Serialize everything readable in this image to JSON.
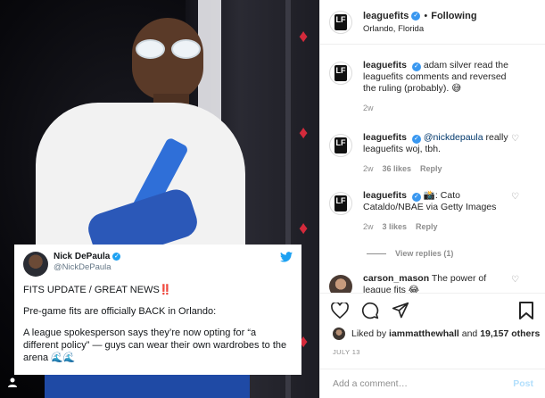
{
  "header": {
    "username": "leaguefits",
    "separator": "•",
    "follow_label": "Following",
    "location": "Orlando, Florida",
    "avatar_text": "LF"
  },
  "tweet": {
    "name": "Nick DePaula",
    "handle": "@NickDePaula",
    "line1": "FITS UPDATE / GREAT NEWS",
    "line1_emoji": "‼️",
    "line2": "Pre-game fits are officially BACK in Orlando:",
    "line3": "A league spokesperson says they’re now opting for “a different policy” — guys can wear their own wardrobes to the arena",
    "line3_emoji": "🌊🌊"
  },
  "comments": [
    {
      "username": "leaguefits",
      "text": "adam silver read the leaguefits comments and reversed the ruling (probably). 😅",
      "time": "2w"
    },
    {
      "username": "leaguefits",
      "mention": "@nickdepaula",
      "text": "really leaguefits woj, tbh.",
      "time": "2w",
      "likes": "36 likes",
      "reply": "Reply"
    },
    {
      "username": "leaguefits",
      "text": "📸: Cato Cataldo/NBAE via Getty Images",
      "time": "2w",
      "likes": "3 likes",
      "reply": "Reply",
      "view_replies": "View replies (1)"
    },
    {
      "username": "carson_mason",
      "text": "The power of league fits 😂"
    }
  ],
  "likes": {
    "prefix": "Liked by",
    "user": "iammatthewhall",
    "conj": "and",
    "others": "19,157 others"
  },
  "date": "JULY 13",
  "add_comment": {
    "placeholder": "Add a comment…",
    "post_label": "Post"
  },
  "colors": {
    "link": "#00376b",
    "verified": "#3897f0",
    "twitter": "#1da1f2",
    "post_disabled": "#b2dffc"
  }
}
